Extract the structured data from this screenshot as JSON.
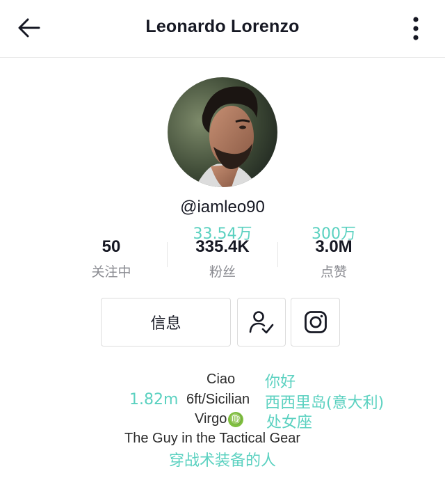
{
  "header": {
    "title": "Leonardo Lorenzo"
  },
  "profile": {
    "username": "@iamleo90"
  },
  "stats": [
    {
      "value": "50",
      "label": "关注中",
      "translation": ""
    },
    {
      "value": "335.4K",
      "label": "粉丝",
      "translation": "33.54万"
    },
    {
      "value": "3.0M",
      "label": "点赞",
      "translation": "300万"
    }
  ],
  "actions": {
    "info_label": "信息"
  },
  "bio": {
    "line1": "Ciao",
    "line1_translation": "你好",
    "line2_prefix_translation": "1.82m",
    "line2": "6ft/Sicilian",
    "line2_translation": "西西里岛(意大利)",
    "line3": "Virgo",
    "line3_symbol": "♍",
    "line3_translation": "处女座",
    "line4": "The Guy in the Tactical Gear",
    "line4_translation": "穿战术装备的人"
  },
  "colors": {
    "translation_teal": "#5bd1c0",
    "label_gray": "#8a8b91",
    "text_dark": "#161823",
    "virgo_green": "#7fbf3e"
  },
  "icons": {
    "back": "arrow-left-icon",
    "more": "more-vertical-icon",
    "follow": "user-check-icon",
    "instagram": "instagram-icon"
  }
}
